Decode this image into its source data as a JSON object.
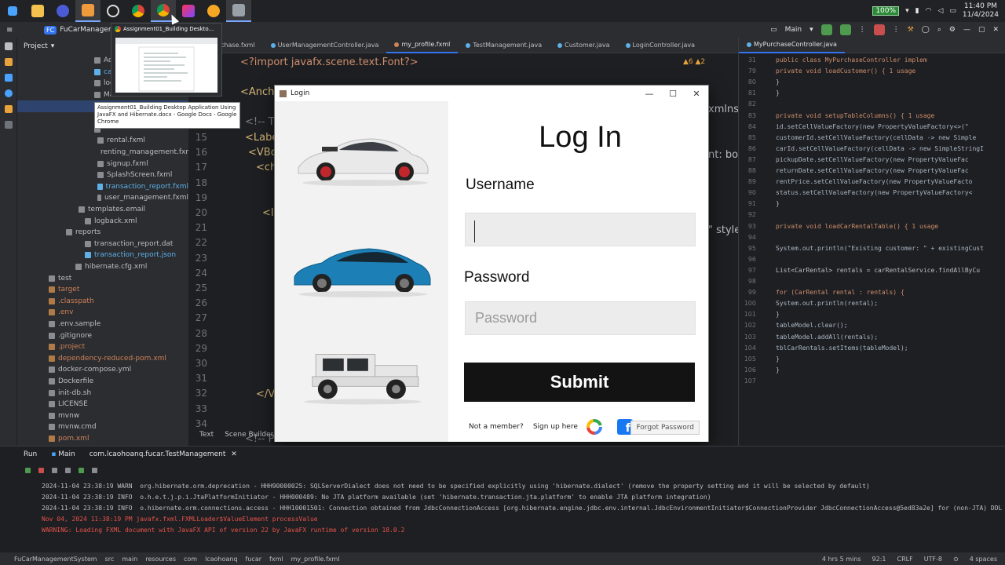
{
  "taskbar": {
    "battery": "100%",
    "time": "11:40 PM",
    "date": "11/4/2024"
  },
  "ide": {
    "project_badge": "FC",
    "project_name": "FuCarManagement",
    "branch": "Main",
    "project_panel_title": "Project"
  },
  "chrome_preview": {
    "title": "Assignment01_Building Deskto...",
    "tooltip": "Assignment01_Building Desktop Application Using JavaFX and Hibernate.docx - Google Docs - Google Chrome"
  },
  "tree": [
    {
      "label": "Adr",
      "color": "normal"
    },
    {
      "label": "car.",
      "color": "blue"
    },
    {
      "label": "log",
      "color": "normal"
    },
    {
      "label": "Ma",
      "color": "normal"
    },
    {
      "label": "",
      "color": "selected"
    },
    {
      "label": "",
      "color": "normal"
    },
    {
      "label": "",
      "color": "normal"
    },
    {
      "label": "rental.fxml",
      "color": "normal"
    },
    {
      "label": "renting_management.fxml",
      "color": "normal"
    },
    {
      "label": "signup.fxml",
      "color": "normal"
    },
    {
      "label": "SplashScreen.fxml",
      "color": "normal"
    },
    {
      "label": "transaction_report.fxml",
      "color": "blue"
    },
    {
      "label": "user_management.fxml",
      "color": "normal"
    },
    {
      "label": "templates.email",
      "color": "normal"
    },
    {
      "label": "logback.xml",
      "color": "normal"
    },
    {
      "label": "reports",
      "color": "normal"
    },
    {
      "label": "transaction_report.dat",
      "color": "normal"
    },
    {
      "label": "transaction_report.json",
      "color": "blue"
    },
    {
      "label": "hibernate.cfg.xml",
      "color": "normal"
    },
    {
      "label": "test",
      "color": "normal"
    },
    {
      "label": "target",
      "color": "orange"
    },
    {
      "label": ".classpath",
      "color": "orange"
    },
    {
      "label": ".env",
      "color": "orange"
    },
    {
      "label": ".env.sample",
      "color": "normal"
    },
    {
      "label": ".gitignore",
      "color": "normal"
    },
    {
      "label": ".project",
      "color": "orange"
    },
    {
      "label": "dependency-reduced-pom.xml",
      "color": "orange"
    },
    {
      "label": "docker-compose.yml",
      "color": "normal"
    },
    {
      "label": "Dockerfile",
      "color": "normal"
    },
    {
      "label": "init-db.sh",
      "color": "normal"
    },
    {
      "label": "LICENSE",
      "color": "normal"
    },
    {
      "label": "mvnw",
      "color": "normal"
    },
    {
      "label": "mvnw.cmd",
      "color": "normal"
    },
    {
      "label": "pom.xml",
      "color": "orange"
    },
    {
      "label": "README.md",
      "color": "normal"
    }
  ],
  "left_tabs": [
    "y_purchase.fxml",
    "UserManagementController.java",
    "my_profile.fxml",
    "TestManagement.java",
    "Customer.java",
    "LoginController.java"
  ],
  "left_code": {
    "line_numbers": [
      "15",
      "16",
      "17",
      "18",
      "19",
      "20",
      "21",
      "22",
      "23",
      "24",
      "25",
      "26",
      "27",
      "28",
      "29",
      "30",
      "31",
      "32",
      "33",
      "34"
    ],
    "import_line": "<?import javafx.scene.text.Font?>",
    "anchor": "<Ancho",
    "comment": "<!-- T",
    "label": "<Labe",
    "vbox": "<VBo",
    "ch": "<ch",
    "img": "<In",
    "vbo_close": "</VBo",
    "comment2": "<!-- P",
    "right_text1": "xmlns=\"",
    "right_text2": "nt: bo",
    "right_text3": "\" style"
  },
  "warnings": "▲6 ▲2",
  "right_tab": "MyPurchaseController.java",
  "right_code": [
    {
      "ln": "31",
      "text": "public class MyPurchaseController implem"
    },
    {
      "ln": "79",
      "text": "  private void loadCustomer() {  1 usage"
    },
    {
      "ln": "80",
      "text": "    }"
    },
    {
      "ln": "81",
      "text": "  }"
    },
    {
      "ln": "82",
      "text": ""
    },
    {
      "ln": "83",
      "text": "  private void setupTableColumns() {  1 usage"
    },
    {
      "ln": "84",
      "text": "    id.setCellValueFactory(new PropertyValueFactory<>(\""
    },
    {
      "ln": "85",
      "text": "    customerId.setCellValueFactory(cellData -> new Simple"
    },
    {
      "ln": "86",
      "text": "    carId.setCellValueFactory(cellData -> new SimpleStringI"
    },
    {
      "ln": "87",
      "text": "    pickupDate.setCellValueFactory(new PropertyValueFac"
    },
    {
      "ln": "88",
      "text": "    returnDate.setCellValueFactory(new PropertyValueFac"
    },
    {
      "ln": "89",
      "text": "    rentPrice.setCellValueFactory(new PropertyValueFacto"
    },
    {
      "ln": "90",
      "text": "    status.setCellValueFactory(new PropertyValueFactory<"
    },
    {
      "ln": "91",
      "text": "  }"
    },
    {
      "ln": "92",
      "text": ""
    },
    {
      "ln": "93",
      "text": "  private void loadCarRentalTable() {  1 usage"
    },
    {
      "ln": "94",
      "text": ""
    },
    {
      "ln": "95",
      "text": "    System.out.println(\"Existing customer: \" + existingCust"
    },
    {
      "ln": "96",
      "text": ""
    },
    {
      "ln": "97",
      "text": "    List<CarRental> rentals = carRentalService.findAllByCu"
    },
    {
      "ln": "98",
      "text": ""
    },
    {
      "ln": "99",
      "text": "    for (CarRental rental : rentals) {"
    },
    {
      "ln": "100",
      "text": "      System.out.println(rental);"
    },
    {
      "ln": "101",
      "text": "    }"
    },
    {
      "ln": "102",
      "text": "    tableModel.clear();"
    },
    {
      "ln": "103",
      "text": "    tableModel.addAll(rentals);"
    },
    {
      "ln": "104",
      "text": "    tblCarRentals.setItems(tableModel);"
    },
    {
      "ln": "105",
      "text": "  }"
    },
    {
      "ln": "106",
      "text": "}"
    },
    {
      "ln": "107",
      "text": ""
    }
  ],
  "login": {
    "window_title": "Login",
    "heading": "Log In",
    "username_label": "Username",
    "username_value": "",
    "password_label": "Password",
    "password_placeholder": "Password",
    "submit_label": "Submit",
    "not_member": "Not a member?",
    "sign_up": "Sign up here",
    "forgot_password": "Forgot Password"
  },
  "editor_bottom_tabs": [
    "Text",
    "Scene Builder"
  ],
  "run": {
    "label": "Run",
    "tab_main": "Main",
    "tab_test": "com.lcaohoanq.fucar.TestManagement"
  },
  "log_lines": [
    {
      "cls": "log-info",
      "text": "2024-11-04 23:38:19 WARN  org.hibernate.orm.deprecation - HHH90000025: SQLServerDialect does not need to be specified explicitly using 'hibernate.dialect' (remove the property setting and it will be selected by default)"
    },
    {
      "cls": "log-info",
      "text": "2024-11-04 23:38:19 INFO  o.h.e.t.j.p.i.JtaPlatformInitiator - HHH000489: No JTA platform available (set 'hibernate.transaction.jta.platform' to enable JTA platform integration)"
    },
    {
      "cls": "log-info",
      "text": "2024-11-04 23:38:19 INFO  o.hibernate.orm.connections.access - HHH10001501: Connection obtained from JdbcConnectionAccess [org.hibernate.engine.jdbc.env.internal.JdbcEnvironmentInitiator$ConnectionProvider JdbcConnectionAccess@5ed83a2e] for (non-JTA) DDL exec"
    },
    {
      "cls": "log-warn",
      "text": "Nov 04, 2024 11:38:19 PM javafx.fxml.FXMLLoader$ValueElement processValue"
    },
    {
      "cls": "log-warn",
      "text": "WARNING: Loading FXML document with JavaFX API of version 22 by JavaFX runtime of version 18.0.2"
    }
  ],
  "status": {
    "breadcrumb": [
      "FuCarManagementSystem",
      "src",
      "main",
      "resources",
      "com",
      "lcaohoanq",
      "fucar",
      "fxml",
      "my_profile.fxml"
    ],
    "time_spent": "4 hrs 5 mins",
    "position": "92:1",
    "line_ending": "CRLF",
    "encoding": "UTF-8",
    "indent": "4 spaces"
  }
}
